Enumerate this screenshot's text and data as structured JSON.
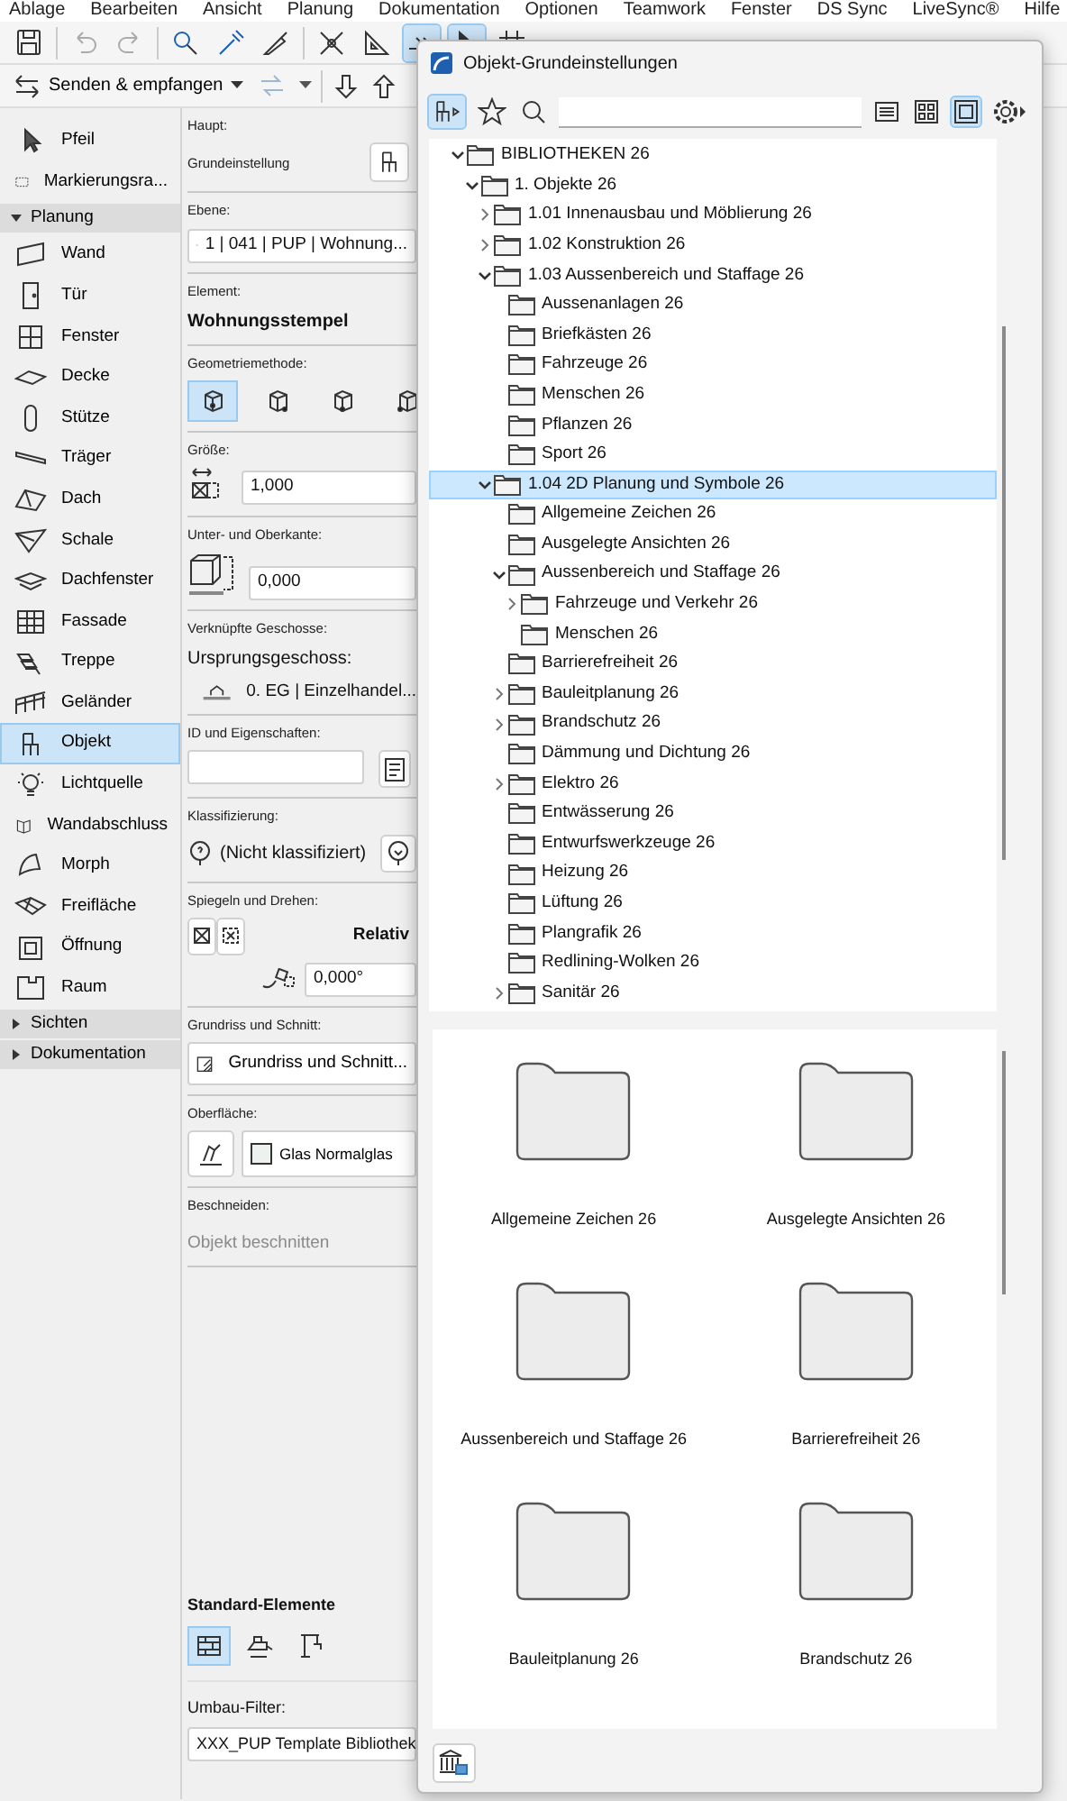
{
  "menu": [
    "Ablage",
    "Bearbeiten",
    "Ansicht",
    "Planung",
    "Dokumentation",
    "Optionen",
    "Teamwork",
    "Fenster",
    "DS Sync",
    "LiveSync®",
    "Hilfe"
  ],
  "toolbar": {
    "send_receive": "Senden & empfangen"
  },
  "toolbox": {
    "tools": [
      {
        "label": "Pfeil",
        "selected": false
      },
      {
        "label": "Markierungsra...",
        "selected": false
      }
    ],
    "sections": [
      {
        "label": "Planung",
        "expanded": true,
        "tools": [
          {
            "label": "Wand",
            "selected": false
          },
          {
            "label": "Tür",
            "selected": false
          },
          {
            "label": "Fenster",
            "selected": false
          },
          {
            "label": "Decke",
            "selected": false
          },
          {
            "label": "Stütze",
            "selected": false
          },
          {
            "label": "Träger",
            "selected": false
          },
          {
            "label": "Dach",
            "selected": false
          },
          {
            "label": "Schale",
            "selected": false
          },
          {
            "label": "Dachfenster",
            "selected": false
          },
          {
            "label": "Fassade",
            "selected": false
          },
          {
            "label": "Treppe",
            "selected": false
          },
          {
            "label": "Geländer",
            "selected": false
          },
          {
            "label": "Objekt",
            "selected": true
          },
          {
            "label": "Lichtquelle",
            "selected": false
          },
          {
            "label": "Wandabschluss",
            "selected": false
          },
          {
            "label": "Morph",
            "selected": false
          },
          {
            "label": "Freifläche",
            "selected": false
          },
          {
            "label": "Öffnung",
            "selected": false
          },
          {
            "label": "Raum",
            "selected": false
          }
        ]
      },
      {
        "label": "Sichten",
        "expanded": false
      },
      {
        "label": "Dokumentation",
        "expanded": false
      }
    ]
  },
  "properties": {
    "main": {
      "title": "Haupt:",
      "label": "Grundeinstellung"
    },
    "layer": {
      "title": "Ebene:",
      "value": "1 | 041 | PUP | Wohnung..."
    },
    "element": {
      "title": "Element:",
      "value": "Wohnungsstempel"
    },
    "geometry": {
      "title": "Geometriemethode:",
      "options": [
        {
          "selected": true
        },
        {
          "selected": false
        },
        {
          "selected": false
        },
        {
          "selected": false
        }
      ]
    },
    "size": {
      "title": "Größe:",
      "value": "1,000"
    },
    "elevation": {
      "title": "Unter- und Oberkante:",
      "value": "0,000"
    },
    "stories": {
      "title": "Verknüpfte Geschosse:",
      "label": "Ursprungsgeschoss:",
      "value": "0. EG | Einzelhandel..."
    },
    "id": {
      "title": "ID und Eigenschaften:"
    },
    "classification": {
      "title": "Klassifizierung:",
      "value": "(Nicht klassifiziert)"
    },
    "mirror": {
      "title": "Spiegeln und Drehen:",
      "label": "Relativ",
      "angle": "0,000°"
    },
    "plan": {
      "title": "Grundriss und Schnitt:",
      "value": "Grundriss und Schnitt..."
    },
    "surface": {
      "title": "Oberfläche:",
      "value": "Glas Normalglas"
    },
    "trim": {
      "title": "Beschneiden:",
      "value": "Objekt beschnitten",
      "disabled": true
    },
    "standard": {
      "title": "Standard-Elemente",
      "options": [
        {
          "selected": true
        },
        {
          "selected": false
        },
        {
          "selected": false
        }
      ]
    },
    "renovation": {
      "title": "Umbau-Filter:",
      "value": "XXX_PUP Template Bibliothek"
    }
  },
  "dialog": {
    "title": "Objekt-Grundeinstellungen",
    "toolbar": {
      "type_filter": {
        "selected": true
      },
      "views": [
        {
          "selected": false
        },
        {
          "selected": false
        },
        {
          "selected": true
        }
      ]
    },
    "tree": [
      {
        "label": "BIBLIOTHEKEN 26",
        "expanded": true,
        "selected": false,
        "children": [
          {
            "label": "1. Objekte 26",
            "expanded": true,
            "selected": false,
            "children": [
              {
                "label": "1.01 Innenausbau und Möblierung 26",
                "expanded": false,
                "selected": false
              },
              {
                "label": "1.02 Konstruktion 26",
                "expanded": false,
                "selected": false
              },
              {
                "label": "1.03 Aussenbereich und Staffage 26",
                "expanded": true,
                "selected": false,
                "children": [
                  {
                    "label": "Aussenanlagen 26",
                    "selected": false
                  },
                  {
                    "label": "Briefkästen 26",
                    "selected": false
                  },
                  {
                    "label": "Fahrzeuge 26",
                    "selected": false
                  },
                  {
                    "label": "Menschen 26",
                    "selected": false
                  },
                  {
                    "label": "Pflanzen 26",
                    "selected": false
                  },
                  {
                    "label": "Sport 26",
                    "selected": false
                  }
                ]
              },
              {
                "label": "1.04 2D Planung und Symbole 26",
                "expanded": true,
                "selected": true,
                "children": [
                  {
                    "label": "Allgemeine Zeichen 26",
                    "selected": false
                  },
                  {
                    "label": "Ausgelegte Ansichten 26",
                    "selected": false
                  },
                  {
                    "label": "Aussenbereich und Staffage 26",
                    "expanded": true,
                    "selected": false,
                    "children": [
                      {
                        "label": "Fahrzeuge und Verkehr 26",
                        "expanded": false,
                        "selected": false
                      },
                      {
                        "label": "Menschen 26",
                        "selected": false
                      }
                    ]
                  },
                  {
                    "label": "Barrierefreiheit 26",
                    "selected": false
                  },
                  {
                    "label": "Bauleitplanung 26",
                    "expanded": false,
                    "selected": false
                  },
                  {
                    "label": "Brandschutz 26",
                    "expanded": false,
                    "selected": false
                  },
                  {
                    "label": "Dämmung und Dichtung 26",
                    "selected": false
                  },
                  {
                    "label": "Elektro 26",
                    "expanded": false,
                    "selected": false
                  },
                  {
                    "label": "Entwässerung 26",
                    "selected": false
                  },
                  {
                    "label": "Entwurfswerkzeuge 26",
                    "selected": false
                  },
                  {
                    "label": "Heizung 26",
                    "selected": false
                  },
                  {
                    "label": "Lüftung 26",
                    "selected": false
                  },
                  {
                    "label": "Plangrafik 26",
                    "selected": false
                  },
                  {
                    "label": "Redlining-Wolken 26",
                    "selected": false
                  },
                  {
                    "label": "Sanitär 26",
                    "expanded": false,
                    "selected": false
                  }
                ]
              }
            ]
          }
        ]
      }
    ],
    "grid": [
      "Allgemeine Zeichen 26",
      "Ausgelegte Ansichten 26",
      "Aussenbereich und Staffage 26",
      "Barrierefreiheit 26",
      "Bauleitplanung 26",
      "Brandschutz 26"
    ]
  }
}
